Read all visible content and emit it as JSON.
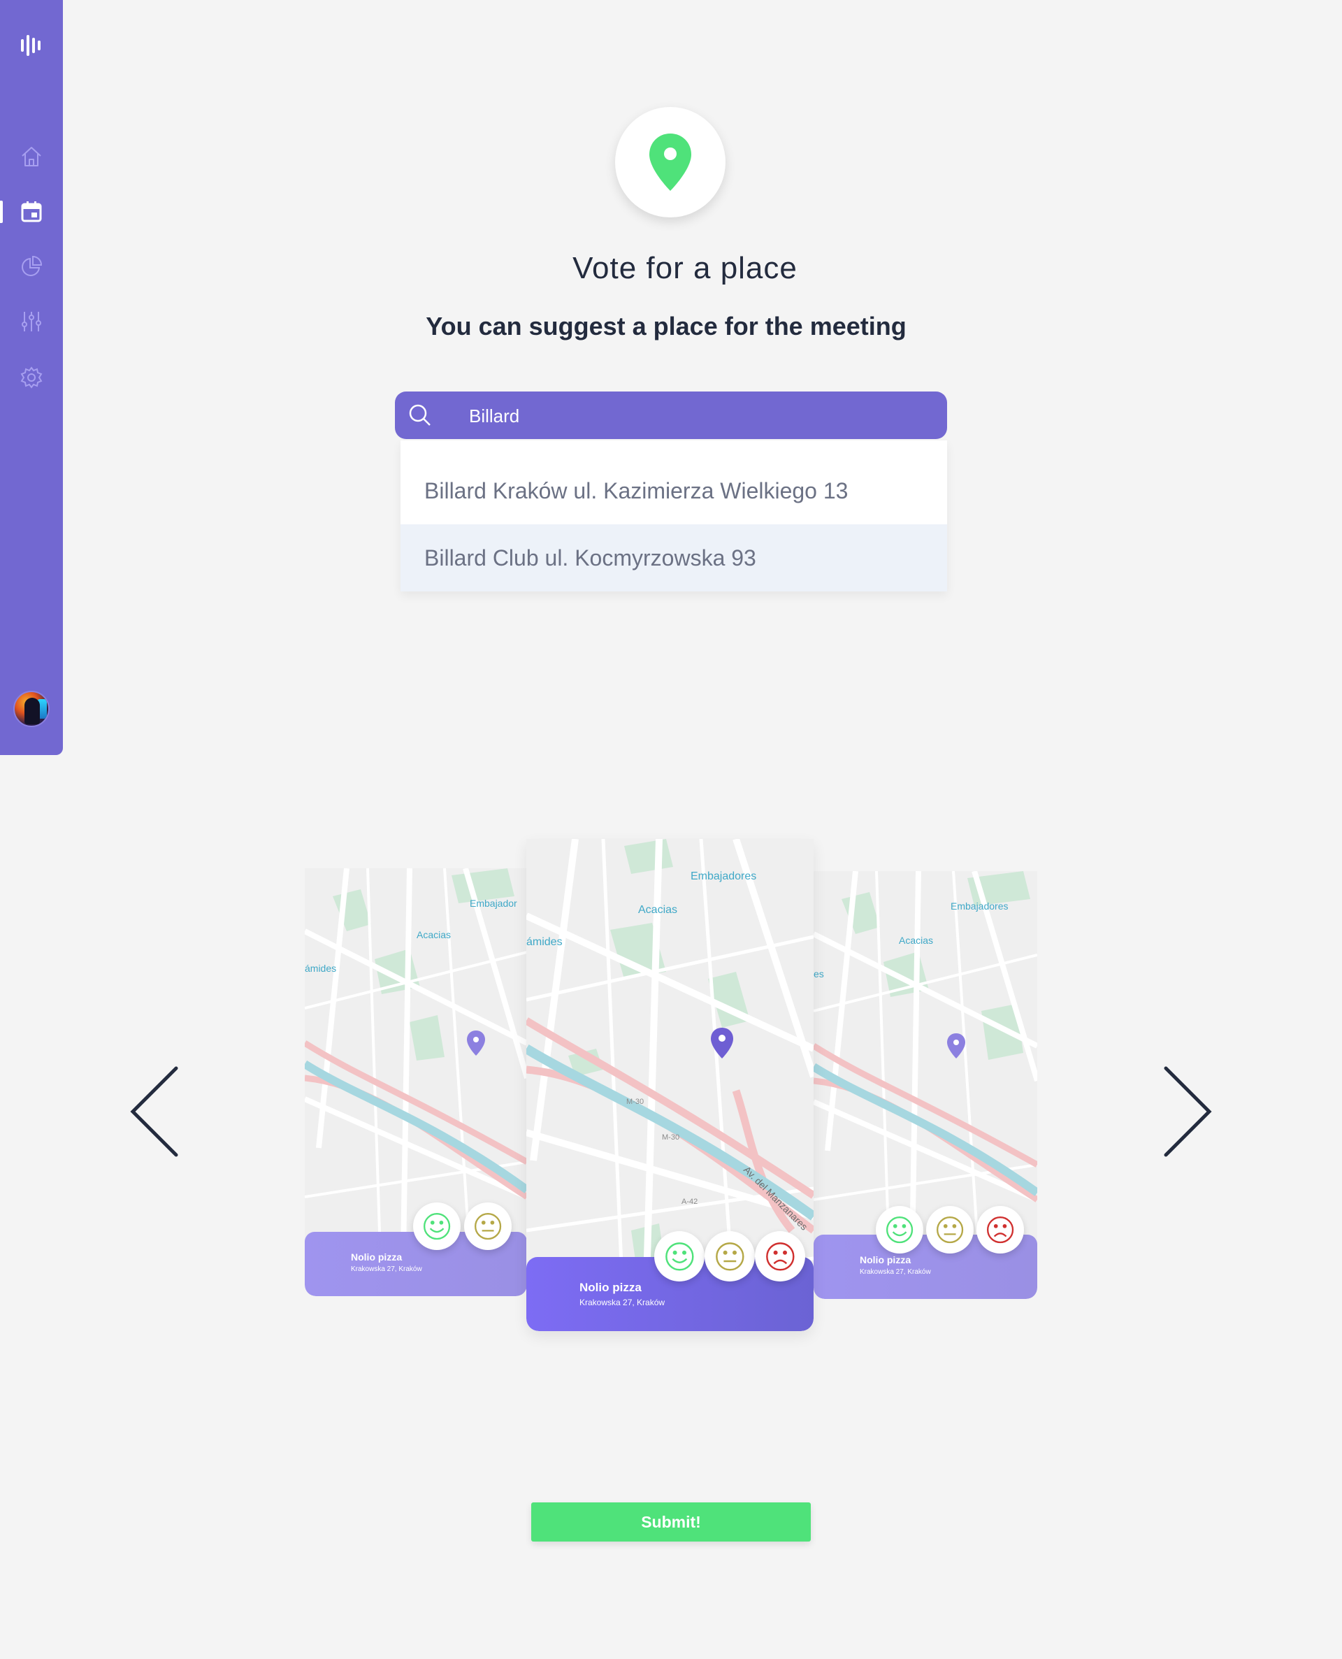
{
  "sidebar": {
    "logo_icon": "bars-logo-icon",
    "items": [
      {
        "icon": "home-icon",
        "active": false
      },
      {
        "icon": "calendar-icon",
        "active": true
      },
      {
        "icon": "pie-chart-icon",
        "active": false
      },
      {
        "icon": "sliders-icon",
        "active": false
      },
      {
        "icon": "gear-icon",
        "active": false
      }
    ],
    "avatar_icon": "user-avatar"
  },
  "header": {
    "icon": "location-pin-icon",
    "title": "Vote for a place",
    "subtitle": "You can suggest a place for the meeting"
  },
  "search": {
    "value": "Billard",
    "suggestions": [
      "Billard Kraków ul. Kazimierza Wielkiego 13",
      "Billard Club ul. Kocmyrzowska 93"
    ],
    "highlighted_index": 1
  },
  "carousel": {
    "prev_icon": "chevron-left-icon",
    "next_icon": "chevron-right-icon",
    "cards": [
      {
        "name": "Nolio pizza",
        "address": "Krakowska 27, Kraków"
      },
      {
        "name": "Nolio pizza",
        "address": "Krakowska 27, Kraków"
      },
      {
        "name": "Nolio pizza",
        "address": "Krakowska 27, Kraków"
      }
    ],
    "map_labels": {
      "embajadores": "Embajadores",
      "embajador": "Embajador",
      "acacias": "Acacias",
      "piramides": "ámides",
      "piramides_short": "es",
      "m30": "M-30",
      "a42": "A-42",
      "rio": "Av. del Manzanares"
    },
    "vote_icons": [
      "smile-face-icon",
      "neutral-face-icon",
      "sad-face-icon"
    ]
  },
  "submit": {
    "label": "Submit!"
  },
  "colors": {
    "brand": "#7268d1",
    "accent_green": "#4fe27a",
    "background": "#f4f4f4",
    "smile": "#4fe27a",
    "neutral": "#b5a847",
    "sad": "#d0302f"
  }
}
